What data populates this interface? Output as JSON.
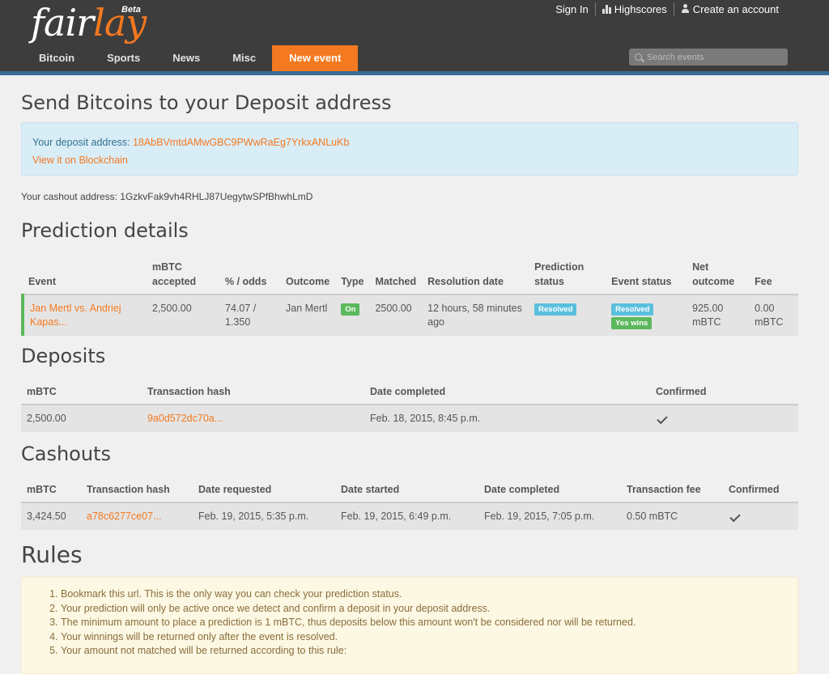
{
  "header": {
    "logo_text_white": "fair",
    "logo_text_orange": "lay",
    "logo_badge": "Beta",
    "links": {
      "sign_in": "Sign In",
      "highscores": "Highscores",
      "create_account": "Create an account"
    },
    "nav": [
      "Bitcoin",
      "Sports",
      "News",
      "Misc",
      "New event"
    ],
    "search_placeholder": "Search events"
  },
  "send": {
    "title": "Send Bitcoins to your Deposit address",
    "deposit_label": "Your deposit address:",
    "deposit_address": "18AbBVmtdAMwGBC9PWwRaEg7YrkxANLuKb",
    "blockchain_link": "View it on Blockchain",
    "cashout_line": "Your cashout address: 1GzkvFak9vh4RHLJ87UegytwSPfBhwhLmD"
  },
  "prediction": {
    "title": "Prediction details",
    "headers": [
      "Event",
      "mBTC accepted",
      "% / odds",
      "Outcome",
      "Type",
      "Matched",
      "Resolution date",
      "Prediction status",
      "Event status",
      "Net outcome",
      "Fee"
    ],
    "row": {
      "event": "Jan Mertl vs. Andriej Kapas...",
      "accepted": "2,500.00",
      "odds": "74.07 / 1.350",
      "outcome": "Jan Mertl",
      "type": "On",
      "matched": "2500.00",
      "resolution": "12 hours, 58 minutes ago",
      "prediction_status": "Resolved",
      "event_status": "Resolved",
      "event_result": "Yes wins",
      "net_outcome": "925.00 mBTC",
      "fee": "0.00 mBTC"
    }
  },
  "deposits": {
    "title": "Deposits",
    "headers": [
      "mBTC",
      "Transaction hash",
      "Date completed",
      "Confirmed"
    ],
    "row": {
      "mbtc": "2,500.00",
      "hash": "9a0d572dc70a...",
      "date": "Feb. 18, 2015, 8:45 p.m."
    }
  },
  "cashouts": {
    "title": "Cashouts",
    "headers": [
      "mBTC",
      "Transaction hash",
      "Date requested",
      "Date started",
      "Date completed",
      "Transaction fee",
      "Confirmed"
    ],
    "row": {
      "mbtc": "3,424.50",
      "hash": "a78c6277ce07...",
      "requested": "Feb. 19, 2015, 5:35 p.m.",
      "started": "Feb. 19, 2015, 6:49 p.m.",
      "completed": "Feb. 19, 2015, 7:05 p.m.",
      "fee": "0.50 mBTC"
    }
  },
  "rules": {
    "title": "Rules",
    "items": [
      "Bookmark this url. This is the only way you can check your prediction status.",
      "Your prediction will only be active once we detect and confirm a deposit in your deposit address.",
      "The minimum amount to place a prediction is 1 mBTC, thus deposits below this amount won't be considered nor will be returned.",
      "Your winnings will be returned only after the event is resolved.",
      "Your amount not matched will be returned according to this rule:"
    ]
  }
}
